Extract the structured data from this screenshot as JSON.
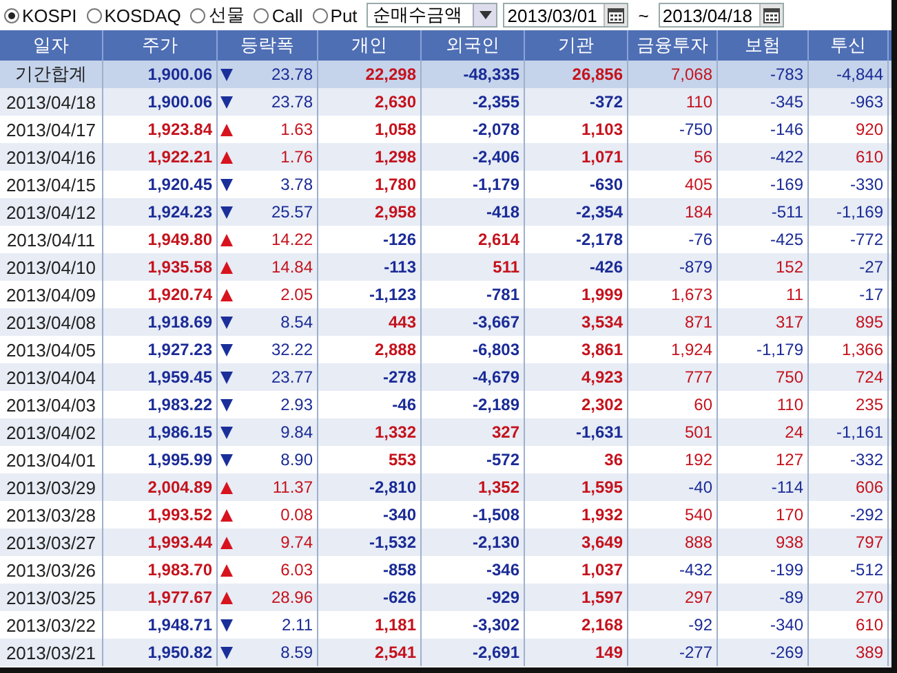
{
  "market_options": [
    {
      "label": "KOSPI",
      "selected": true
    },
    {
      "label": "KOSDAQ",
      "selected": false
    },
    {
      "label": "선물",
      "selected": false
    },
    {
      "label": "Call",
      "selected": false
    },
    {
      "label": "Put",
      "selected": false
    }
  ],
  "measure": {
    "value": "순매수금액"
  },
  "date_from": {
    "value": "2013/03/01"
  },
  "range_separator": "~",
  "date_to": {
    "value": "2013/04/18"
  },
  "table": {
    "columns": [
      "일자",
      "주가",
      "등락폭",
      "개인",
      "외국인",
      "기관",
      "금융투자",
      "보험",
      "투신"
    ],
    "rows": [
      {
        "kind": "total",
        "date": "기간합계",
        "price": "1,900.06",
        "up": false,
        "change": "23.78",
        "individual": "22,298",
        "foreign": "-48,335",
        "institution": "26,856",
        "financial": "7,068",
        "insurance": "-783",
        "trust": "-4,844"
      },
      {
        "kind": "day",
        "date": "2013/04/18",
        "price": "1,900.06",
        "up": false,
        "change": "23.78",
        "individual": "2,630",
        "foreign": "-2,355",
        "institution": "-372",
        "financial": "110",
        "insurance": "-345",
        "trust": "-963"
      },
      {
        "kind": "day",
        "date": "2013/04/17",
        "price": "1,923.84",
        "up": true,
        "change": "1.63",
        "individual": "1,058",
        "foreign": "-2,078",
        "institution": "1,103",
        "financial": "-750",
        "insurance": "-146",
        "trust": "920"
      },
      {
        "kind": "day",
        "date": "2013/04/16",
        "price": "1,922.21",
        "up": true,
        "change": "1.76",
        "individual": "1,298",
        "foreign": "-2,406",
        "institution": "1,071",
        "financial": "56",
        "insurance": "-422",
        "trust": "610"
      },
      {
        "kind": "day",
        "date": "2013/04/15",
        "price": "1,920.45",
        "up": false,
        "change": "3.78",
        "individual": "1,780",
        "foreign": "-1,179",
        "institution": "-630",
        "financial": "405",
        "insurance": "-169",
        "trust": "-330"
      },
      {
        "kind": "day",
        "date": "2013/04/12",
        "price": "1,924.23",
        "up": false,
        "change": "25.57",
        "individual": "2,958",
        "foreign": "-418",
        "institution": "-2,354",
        "financial": "184",
        "insurance": "-511",
        "trust": "-1,169"
      },
      {
        "kind": "day",
        "date": "2013/04/11",
        "price": "1,949.80",
        "up": true,
        "change": "14.22",
        "individual": "-126",
        "foreign": "2,614",
        "institution": "-2,178",
        "financial": "-76",
        "insurance": "-425",
        "trust": "-772"
      },
      {
        "kind": "day",
        "date": "2013/04/10",
        "price": "1,935.58",
        "up": true,
        "change": "14.84",
        "individual": "-113",
        "foreign": "511",
        "institution": "-426",
        "financial": "-879",
        "insurance": "152",
        "trust": "-27"
      },
      {
        "kind": "day",
        "date": "2013/04/09",
        "price": "1,920.74",
        "up": true,
        "change": "2.05",
        "individual": "-1,123",
        "foreign": "-781",
        "institution": "1,999",
        "financial": "1,673",
        "insurance": "11",
        "trust": "-17"
      },
      {
        "kind": "day",
        "date": "2013/04/08",
        "price": "1,918.69",
        "up": false,
        "change": "8.54",
        "individual": "443",
        "foreign": "-3,667",
        "institution": "3,534",
        "financial": "871",
        "insurance": "317",
        "trust": "895"
      },
      {
        "kind": "day",
        "date": "2013/04/05",
        "price": "1,927.23",
        "up": false,
        "change": "32.22",
        "individual": "2,888",
        "foreign": "-6,803",
        "institution": "3,861",
        "financial": "1,924",
        "insurance": "-1,179",
        "trust": "1,366"
      },
      {
        "kind": "day",
        "date": "2013/04/04",
        "price": "1,959.45",
        "up": false,
        "change": "23.77",
        "individual": "-278",
        "foreign": "-4,679",
        "institution": "4,923",
        "financial": "777",
        "insurance": "750",
        "trust": "724"
      },
      {
        "kind": "day",
        "date": "2013/04/03",
        "price": "1,983.22",
        "up": false,
        "change": "2.93",
        "individual": "-46",
        "foreign": "-2,189",
        "institution": "2,302",
        "financial": "60",
        "insurance": "110",
        "trust": "235"
      },
      {
        "kind": "day",
        "date": "2013/04/02",
        "price": "1,986.15",
        "up": false,
        "change": "9.84",
        "individual": "1,332",
        "foreign": "327",
        "institution": "-1,631",
        "financial": "501",
        "insurance": "24",
        "trust": "-1,161"
      },
      {
        "kind": "day",
        "date": "2013/04/01",
        "price": "1,995.99",
        "up": false,
        "change": "8.90",
        "individual": "553",
        "foreign": "-572",
        "institution": "36",
        "financial": "192",
        "insurance": "127",
        "trust": "-332"
      },
      {
        "kind": "day",
        "date": "2013/03/29",
        "price": "2,004.89",
        "up": true,
        "change": "11.37",
        "individual": "-2,810",
        "foreign": "1,352",
        "institution": "1,595",
        "financial": "-40",
        "insurance": "-114",
        "trust": "606"
      },
      {
        "kind": "day",
        "date": "2013/03/28",
        "price": "1,993.52",
        "up": true,
        "change": "0.08",
        "individual": "-340",
        "foreign": "-1,508",
        "institution": "1,932",
        "financial": "540",
        "insurance": "170",
        "trust": "-292"
      },
      {
        "kind": "day",
        "date": "2013/03/27",
        "price": "1,993.44",
        "up": true,
        "change": "9.74",
        "individual": "-1,532",
        "foreign": "-2,130",
        "institution": "3,649",
        "financial": "888",
        "insurance": "938",
        "trust": "797"
      },
      {
        "kind": "day",
        "date": "2013/03/26",
        "price": "1,983.70",
        "up": true,
        "change": "6.03",
        "individual": "-858",
        "foreign": "-346",
        "institution": "1,037",
        "financial": "-432",
        "insurance": "-199",
        "trust": "-512"
      },
      {
        "kind": "day",
        "date": "2013/03/25",
        "price": "1,977.67",
        "up": true,
        "change": "28.96",
        "individual": "-626",
        "foreign": "-929",
        "institution": "1,597",
        "financial": "297",
        "insurance": "-89",
        "trust": "270"
      },
      {
        "kind": "day",
        "date": "2013/03/22",
        "price": "1,948.71",
        "up": false,
        "change": "2.11",
        "individual": "1,181",
        "foreign": "-3,302",
        "institution": "2,168",
        "financial": "-92",
        "insurance": "-340",
        "trust": "610"
      },
      {
        "kind": "day",
        "date": "2013/03/21",
        "price": "1,950.82",
        "up": false,
        "change": "8.59",
        "individual": "2,541",
        "foreign": "-2,691",
        "institution": "149",
        "financial": "-277",
        "insurance": "-269",
        "trust": "389"
      }
    ]
  }
}
